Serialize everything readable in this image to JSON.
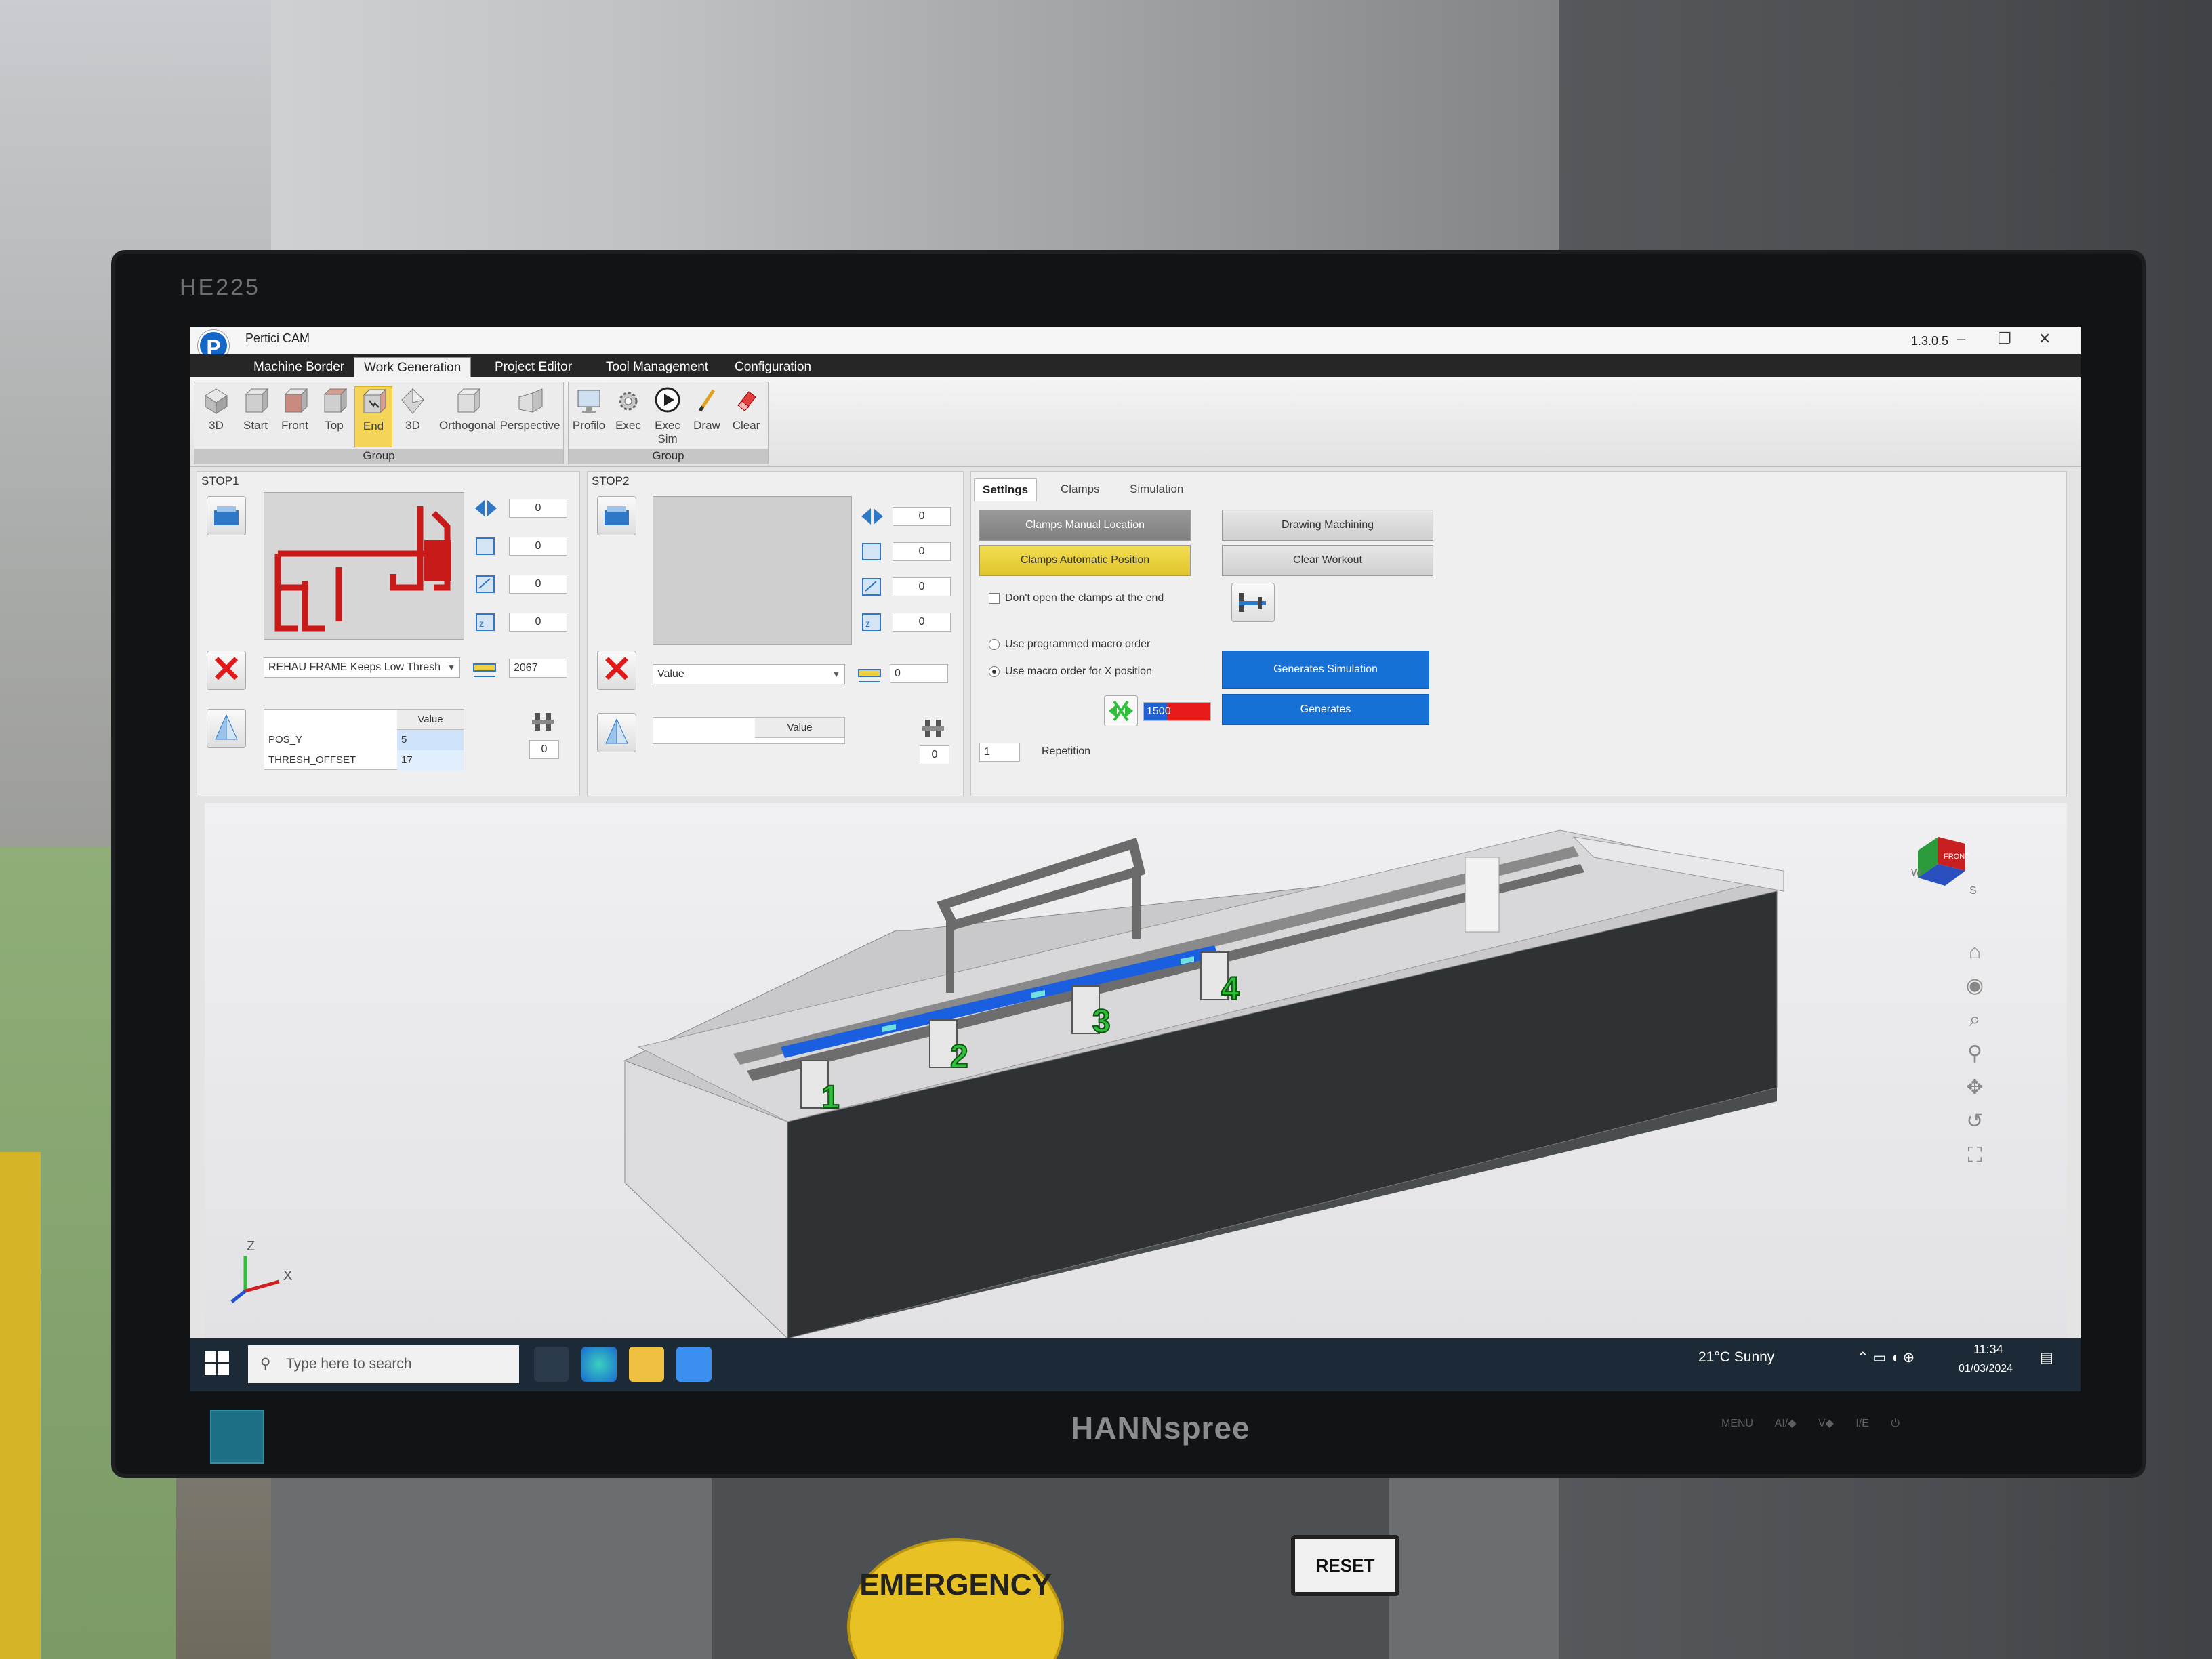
{
  "monitor": {
    "model": "HE225",
    "brand": "HANNspree",
    "buttons": "MENU  AI/◆  V◆  I/E  ⏻"
  },
  "machine": {
    "reset_label": "RESET",
    "estop_label": "EMERGENCY"
  },
  "app": {
    "title": "Pertici CAM",
    "version": "1.3.0.5"
  },
  "menu": {
    "items": [
      "Machine Border",
      "Work Generation",
      "Project Editor",
      "Tool Management",
      "Configuration"
    ],
    "active": "Work Generation"
  },
  "ribbon": {
    "view_buttons": [
      "3D",
      "Start",
      "Front",
      "Top",
      "End",
      "3D",
      "Orthogonal",
      "Perspective"
    ],
    "active_view": "End",
    "group1_label": "Group",
    "action_buttons": [
      "Profilo",
      "Exec",
      "Exec Sim",
      "Draw",
      "Clear"
    ],
    "group2_label": "Group"
  },
  "stop1": {
    "label": "STOP1",
    "offsets": [
      "0",
      "0",
      "0",
      "0"
    ],
    "profile": "REHAU FRAME Keeps Low Thresh",
    "length": "2067",
    "grid_header": "Value",
    "rows": [
      {
        "name": "POS_Y",
        "value": "5"
      },
      {
        "name": "THRESH_OFFSET",
        "value": "17"
      }
    ],
    "clamp_count": "0"
  },
  "stop2": {
    "label": "STOP2",
    "offsets": [
      "0",
      "0",
      "0",
      "0"
    ],
    "profile": "Value",
    "length": "0",
    "grid_header": "Value",
    "clamp_count": "0"
  },
  "settings": {
    "tabs": [
      "Settings",
      "Clamps",
      "Simulation"
    ],
    "active_tab": "Settings",
    "clamps_manual": "Clamps Manual Location",
    "clamps_auto": "Clamps Automatic Position",
    "drawing_machining": "Drawing Machining",
    "clear_workout": "Clear Workout",
    "dont_open": "Don't open the clamps at the end",
    "use_programmed": "Use programmed macro order",
    "use_macro_x": "Use macro order for X position",
    "generates_sim": "Generates Simulation",
    "generates": "Generates",
    "speed_value": "1500",
    "repetition_value": "1",
    "repetition_label": "Repetition"
  },
  "viewport": {
    "clamp_numbers": [
      "1",
      "2",
      "3",
      "4"
    ],
    "cube_face": "FRONT",
    "compass": [
      "W",
      "S"
    ],
    "axes": [
      "Z",
      "X"
    ]
  },
  "taskbar": {
    "search_placeholder": "Type here to search",
    "weather": "21°C  Sunny",
    "time": "11:34",
    "date": "01/03/2024"
  },
  "colors": {
    "accent_blue": "#1770d6",
    "highlight_yellow": "#f3dd52",
    "clamp_green": "#2fbf3a",
    "profile_red": "#c91a1a"
  }
}
